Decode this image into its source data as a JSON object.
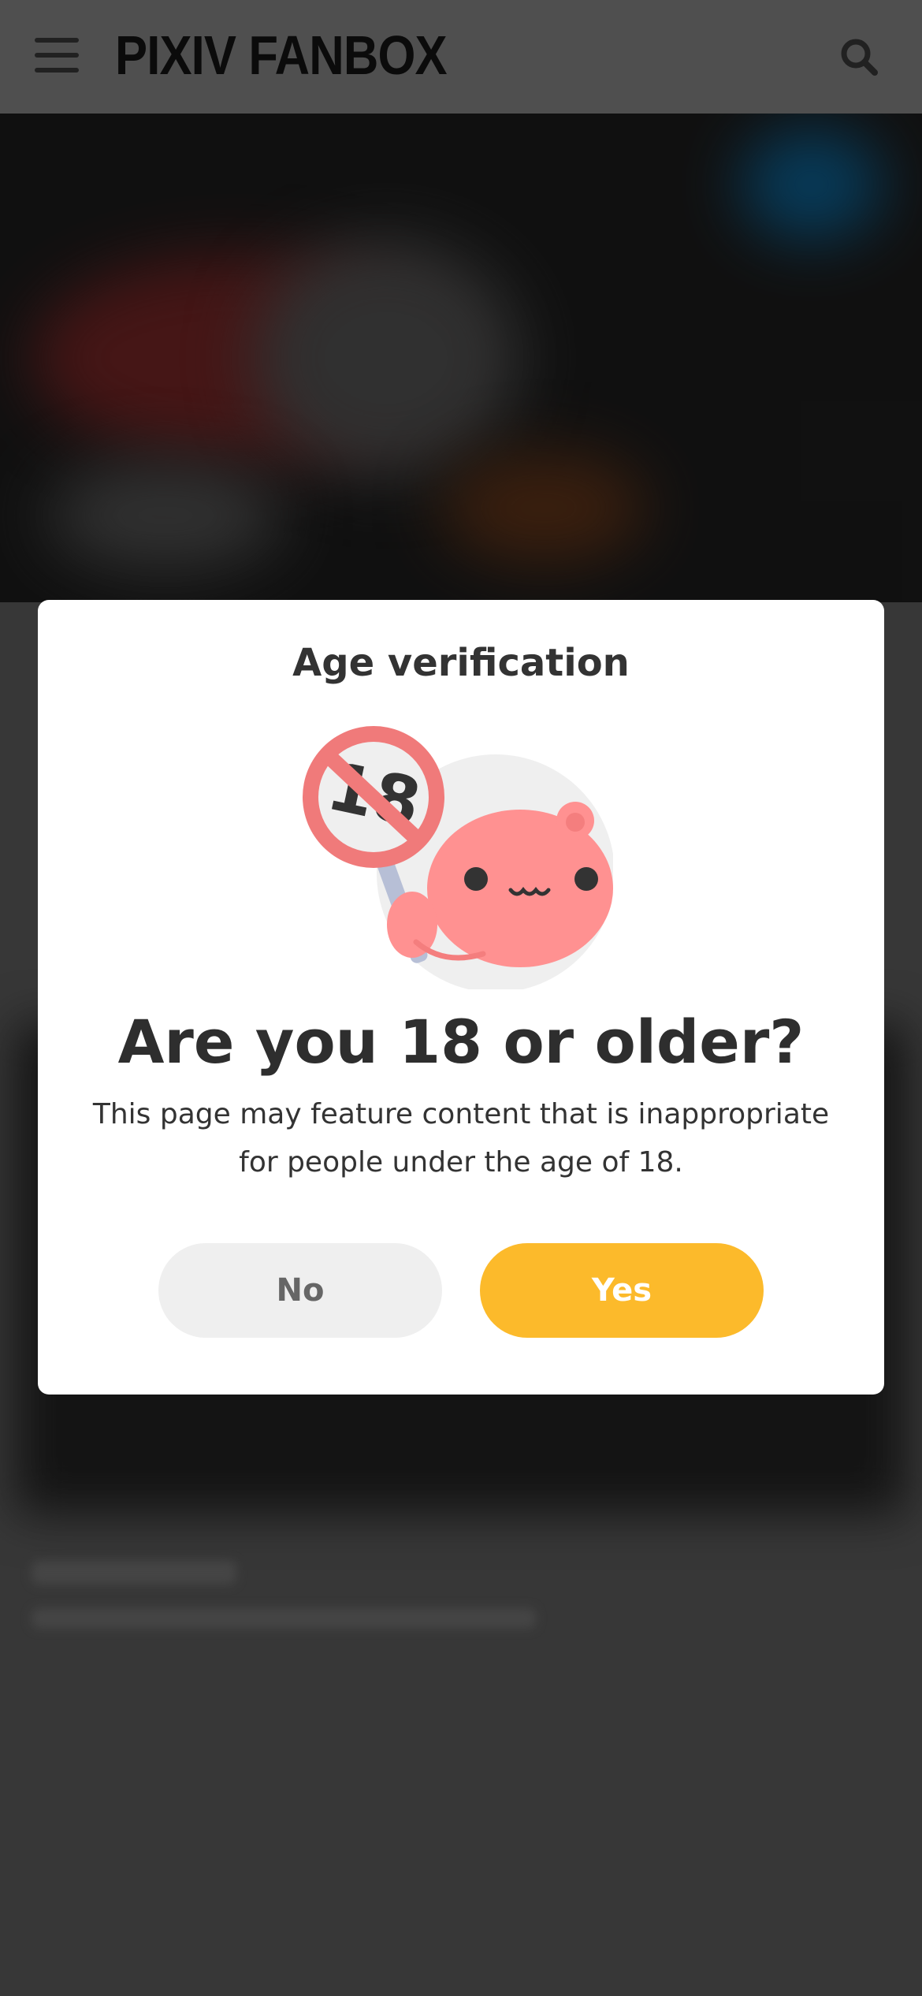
{
  "header": {
    "logo_text": "PIXIV FANBOX",
    "menu_icon": "hamburger-menu-icon",
    "search_icon": "search-icon"
  },
  "modal": {
    "title": "Age verification",
    "illustration": "age-18-restriction-mascot",
    "question": "Are you 18 or older?",
    "description": "This page may feature content that is inappropriate for people under the age of 18.",
    "no_label": "No",
    "yes_label": "Yes"
  },
  "colors": {
    "yes_button": "#fcba2b",
    "no_button": "#efefef",
    "prohibition_sign": "#f07a7a",
    "mascot": "#ff9191"
  }
}
